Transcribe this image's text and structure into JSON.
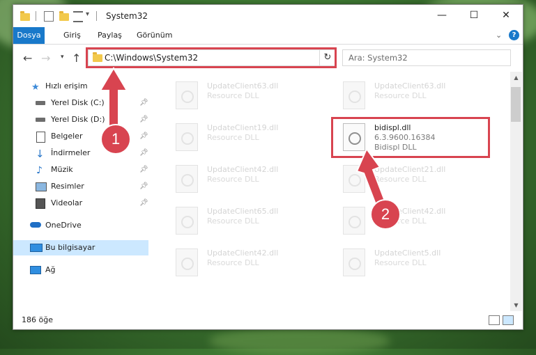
{
  "window": {
    "title": "System32",
    "tabs": [
      "Dosya",
      "Giriş",
      "Paylaş",
      "Görünüm"
    ]
  },
  "address": {
    "path": "C:\\Windows\\System32",
    "search_placeholder": "Ara: System32"
  },
  "nav": {
    "quick_access": "Hızlı erişim",
    "items": [
      {
        "label": "Yerel Disk (C:)",
        "icon": "drive-icon"
      },
      {
        "label": "Yerel Disk (D:)",
        "icon": "drive-icon"
      },
      {
        "label": "Belgeler",
        "icon": "documents-icon"
      },
      {
        "label": "İndirmeler",
        "icon": "download-icon"
      },
      {
        "label": "Müzik",
        "icon": "music-icon"
      },
      {
        "label": "Resimler",
        "icon": "pictures-icon"
      },
      {
        "label": "Videolar",
        "icon": "videos-icon"
      }
    ],
    "onedrive": "OneDrive",
    "this_pc": "Bu bilgisayar",
    "network": "Ağ"
  },
  "files": {
    "col1": [
      {
        "name": "UpdateClient63.dll",
        "type": "Resource DLL"
      },
      {
        "name": "UpdateClient19.dll",
        "type": "Resource DLL"
      },
      {
        "name": "UpdateClient42.dll",
        "type": "Resource DLL"
      },
      {
        "name": "UpdateClient65.dll",
        "type": "Resource DLL"
      },
      {
        "name": "UpdateClient42.dll",
        "type": "Resource DLL"
      }
    ],
    "col2": [
      {
        "name": "UpdateClient63.dll",
        "type": "Resource DLL"
      },
      {
        "name": "UpdateClient21.dll",
        "type": "Resource DLL"
      },
      {
        "name": "UpdateClient42.dll",
        "type": "Resource DLL"
      },
      {
        "name": "UpdateClient5.dll",
        "type": "Resource DLL"
      }
    ],
    "highlighted": {
      "name": "bidispl.dll",
      "version": "6.3.9600.16384",
      "type": "Bidispl DLL"
    }
  },
  "status": {
    "count": "186 öğe"
  },
  "callouts": {
    "one": "1",
    "two": "2"
  },
  "colors": {
    "accent": "#1979ca",
    "callout": "#d84450",
    "selected": "#cce8ff"
  }
}
